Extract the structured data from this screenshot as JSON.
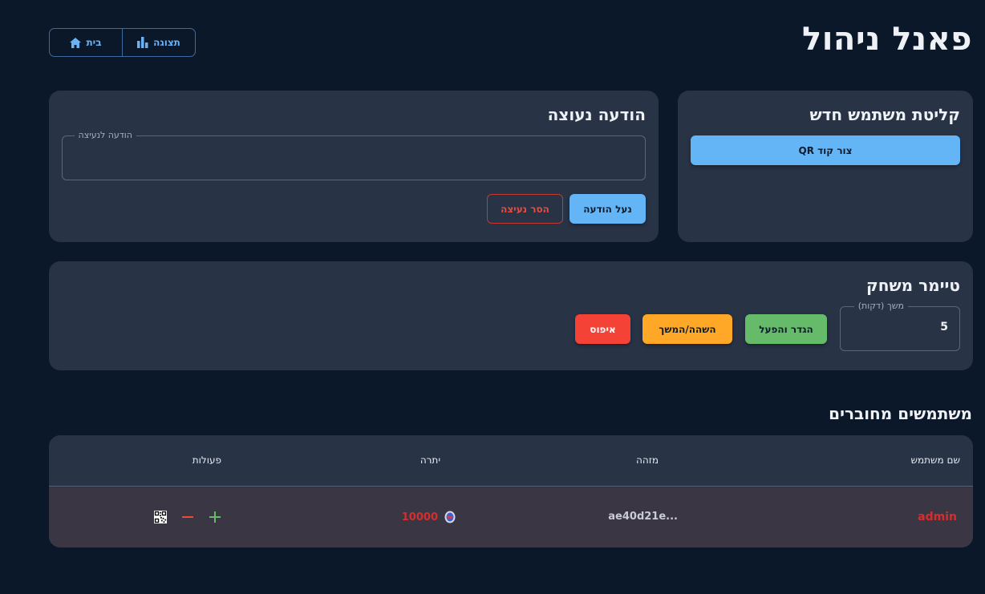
{
  "header": {
    "title": "פאנל ניהול",
    "nav": {
      "home_label": "בית",
      "display_label": "תצוגה"
    }
  },
  "register_card": {
    "title": "קליטת משתמש חדש",
    "qr_button": "צור קוד QR"
  },
  "pinned_card": {
    "title": "הודעה נעוצה",
    "field_legend": "הודעה לנעיצה",
    "field_value": "",
    "pin_button": "נעל הודעה",
    "unpin_button": "הסר נעיצה"
  },
  "timer_card": {
    "title": "טיימר משחק",
    "duration_legend": "משך (דקות)",
    "duration_value": "5",
    "start_button": "הגדר והפעל",
    "pause_button": "השהה/המשך",
    "reset_button": "איפוס"
  },
  "users": {
    "title": "משתמשים מחוברים",
    "columns": {
      "user": "שם משתמש",
      "id": "מזהה",
      "balance": "יתרה",
      "actions": "פעולות"
    },
    "rows": [
      {
        "user": "admin",
        "id": "...ae40d21e",
        "balance": "10000"
      }
    ]
  },
  "colors": {
    "background": "#0b1829",
    "card": "#283346",
    "primary": "#64b5f6",
    "success": "#66bb6a",
    "warning": "#ffa726",
    "danger": "#f44336"
  },
  "icons": [
    "home-icon",
    "bar-chart-icon",
    "qr-code-icon",
    "minus-icon",
    "plus-icon",
    "coin-icon"
  ]
}
